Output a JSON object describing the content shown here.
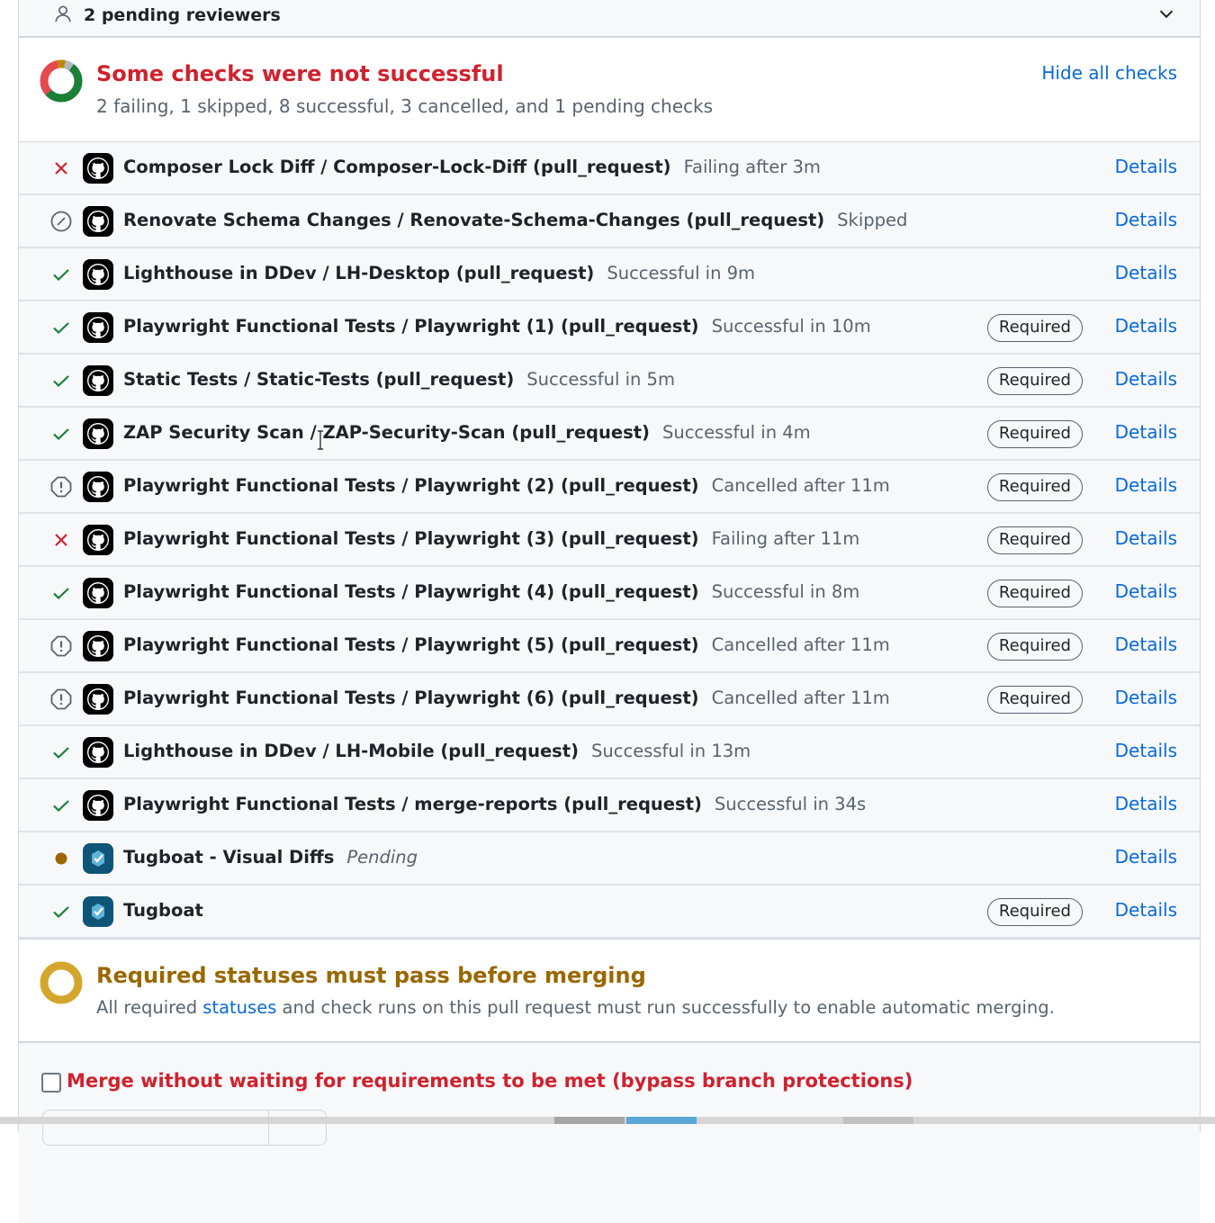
{
  "reviewers": {
    "label": "2 pending reviewers",
    "icon": "person-icon",
    "toggle_icon": "chevron-down-icon"
  },
  "summary": {
    "title": "Some checks were not successful",
    "subtitle": "2 failing, 1 skipped, 8 successful, 3 cancelled, and 1 pending checks",
    "hide_link": "Hide all checks",
    "counts": {
      "failing": 2,
      "skipped": 1,
      "successful": 8,
      "cancelled": 3,
      "pending": 1
    }
  },
  "colors": {
    "failure": "#cf222e",
    "success": "#1a7f37",
    "pending": "#9a6700",
    "neutral": "#59636e",
    "link": "#0969da",
    "warning_ring": "#d4a72c"
  },
  "checks": [
    {
      "status": "failure",
      "app": "github",
      "name": "Composer Lock Diff / Composer-Lock-Diff (pull_request)",
      "description": "Failing after 3m",
      "required": false,
      "details": "Details"
    },
    {
      "status": "skipped",
      "app": "github",
      "name": "Renovate Schema Changes / Renovate-Schema-Changes (pull_request)",
      "description": "Skipped",
      "required": false,
      "details": "Details"
    },
    {
      "status": "success",
      "app": "github",
      "name": "Lighthouse in DDev / LH-Desktop (pull_request)",
      "description": "Successful in 9m",
      "required": false,
      "details": "Details"
    },
    {
      "status": "success",
      "app": "github",
      "name": "Playwright Functional Tests / Playwright (1) (pull_request)",
      "description": "Successful in 10m",
      "required": true,
      "details": "Details"
    },
    {
      "status": "success",
      "app": "github",
      "name": "Static Tests / Static-Tests (pull_request)",
      "description": "Successful in 5m",
      "required": true,
      "details": "Details"
    },
    {
      "status": "success",
      "app": "github",
      "name": "ZAP Security Scan / ZAP-Security-Scan (pull_request)",
      "description": "Successful in 4m",
      "required": true,
      "details": "Details"
    },
    {
      "status": "cancelled",
      "app": "github",
      "name": "Playwright Functional Tests / Playwright (2) (pull_request)",
      "description": "Cancelled after 11m",
      "required": true,
      "details": "Details"
    },
    {
      "status": "failure",
      "app": "github",
      "name": "Playwright Functional Tests / Playwright (3) (pull_request)",
      "description": "Failing after 11m",
      "required": true,
      "details": "Details"
    },
    {
      "status": "success",
      "app": "github",
      "name": "Playwright Functional Tests / Playwright (4) (pull_request)",
      "description": "Successful in 8m",
      "required": true,
      "details": "Details"
    },
    {
      "status": "cancelled",
      "app": "github",
      "name": "Playwright Functional Tests / Playwright (5) (pull_request)",
      "description": "Cancelled after 11m",
      "required": true,
      "details": "Details"
    },
    {
      "status": "cancelled",
      "app": "github",
      "name": "Playwright Functional Tests / Playwright (6) (pull_request)",
      "description": "Cancelled after 11m",
      "required": true,
      "details": "Details"
    },
    {
      "status": "success",
      "app": "github",
      "name": "Lighthouse in DDev / LH-Mobile (pull_request)",
      "description": "Successful in 13m",
      "required": false,
      "details": "Details"
    },
    {
      "status": "success",
      "app": "github",
      "name": "Playwright Functional Tests / merge-reports (pull_request)",
      "description": "Successful in 34s",
      "required": false,
      "details": "Details"
    },
    {
      "status": "pending",
      "app": "tugboat",
      "name": "Tugboat - Visual Diffs",
      "description": "Pending",
      "required": false,
      "details": "Details"
    },
    {
      "status": "success",
      "app": "tugboat",
      "name": "Tugboat",
      "description": "",
      "required": true,
      "details": "Details"
    }
  ],
  "required_label": "Required",
  "merge_requirements": {
    "title": "Required statuses must pass before merging",
    "sub_prefix": "All required ",
    "sub_link": "statuses",
    "sub_suffix": " and check runs on this pull request must run successfully to enable automatic merging."
  },
  "bypass": {
    "label": "Merge without waiting for requirements to be met (bypass branch protections)",
    "checked": false
  }
}
